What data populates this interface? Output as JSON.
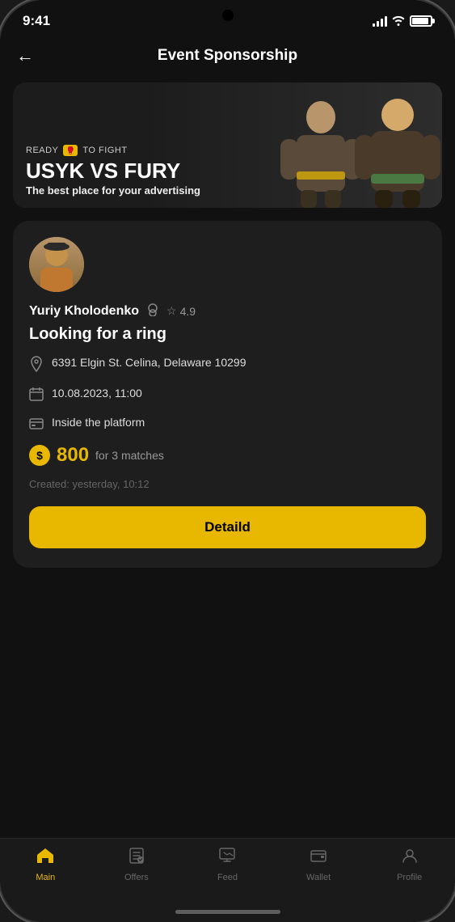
{
  "statusBar": {
    "time": "9:41",
    "batteryLevel": 90
  },
  "header": {
    "backLabel": "←",
    "title": "Event Sponsorship"
  },
  "banner": {
    "topLabel": "READY",
    "topLabelMiddle": "TO FIGHT",
    "title": "USYK VS FURY",
    "subtitle": "The best place for your advertising"
  },
  "card": {
    "userName": "Yuriy Kholodenko",
    "rating": "4.9",
    "postTitle": "Looking for a ring",
    "address": "6391 Elgin St. Celina, Delaware 10299",
    "datetime": "10.08.2023, 11:00",
    "paymentMethod": "Inside the platform",
    "priceAmount": "800",
    "priceSuffix": "for 3 matches",
    "createdText": "Created: yesterday, 10:12",
    "detailButton": "Detaild"
  },
  "bottomNav": {
    "items": [
      {
        "label": "Main",
        "active": true
      },
      {
        "label": "Offers",
        "active": false
      },
      {
        "label": "Feed",
        "active": false
      },
      {
        "label": "Wallet",
        "active": false
      },
      {
        "label": "Profile",
        "active": false
      }
    ]
  }
}
